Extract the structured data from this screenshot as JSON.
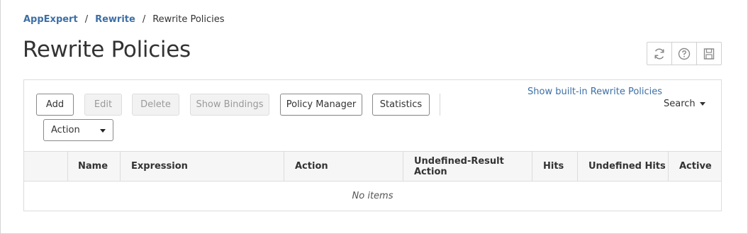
{
  "breadcrumb": {
    "items": [
      "AppExpert",
      "Rewrite"
    ],
    "separator": "/",
    "current": "Rewrite Policies"
  },
  "page": {
    "title": "Rewrite Policies"
  },
  "title_tools": {
    "refresh_icon": "refresh-icon",
    "help_icon": "help-icon",
    "save_icon": "save-icon"
  },
  "toolbar": {
    "add_label": "Add",
    "edit_label": "Edit",
    "delete_label": "Delete",
    "show_bindings_label": "Show Bindings",
    "policy_manager_label": "Policy Manager",
    "statistics_label": "Statistics",
    "builtin_link": "Show built-in Rewrite Policies",
    "search_label": "Search",
    "action_select_value": "Action"
  },
  "table": {
    "columns": [
      "Name",
      "Expression",
      "Action",
      "Undefined-Result Action",
      "Hits",
      "Undefined Hits",
      "Active"
    ],
    "empty_text": "No items"
  },
  "colors": {
    "link": "#3d6fa6",
    "header_bg": "#f6f6f6",
    "border": "#dcdcdc",
    "disabled_bg": "#f2f2f2",
    "disabled_text": "#9a9a9a"
  }
}
